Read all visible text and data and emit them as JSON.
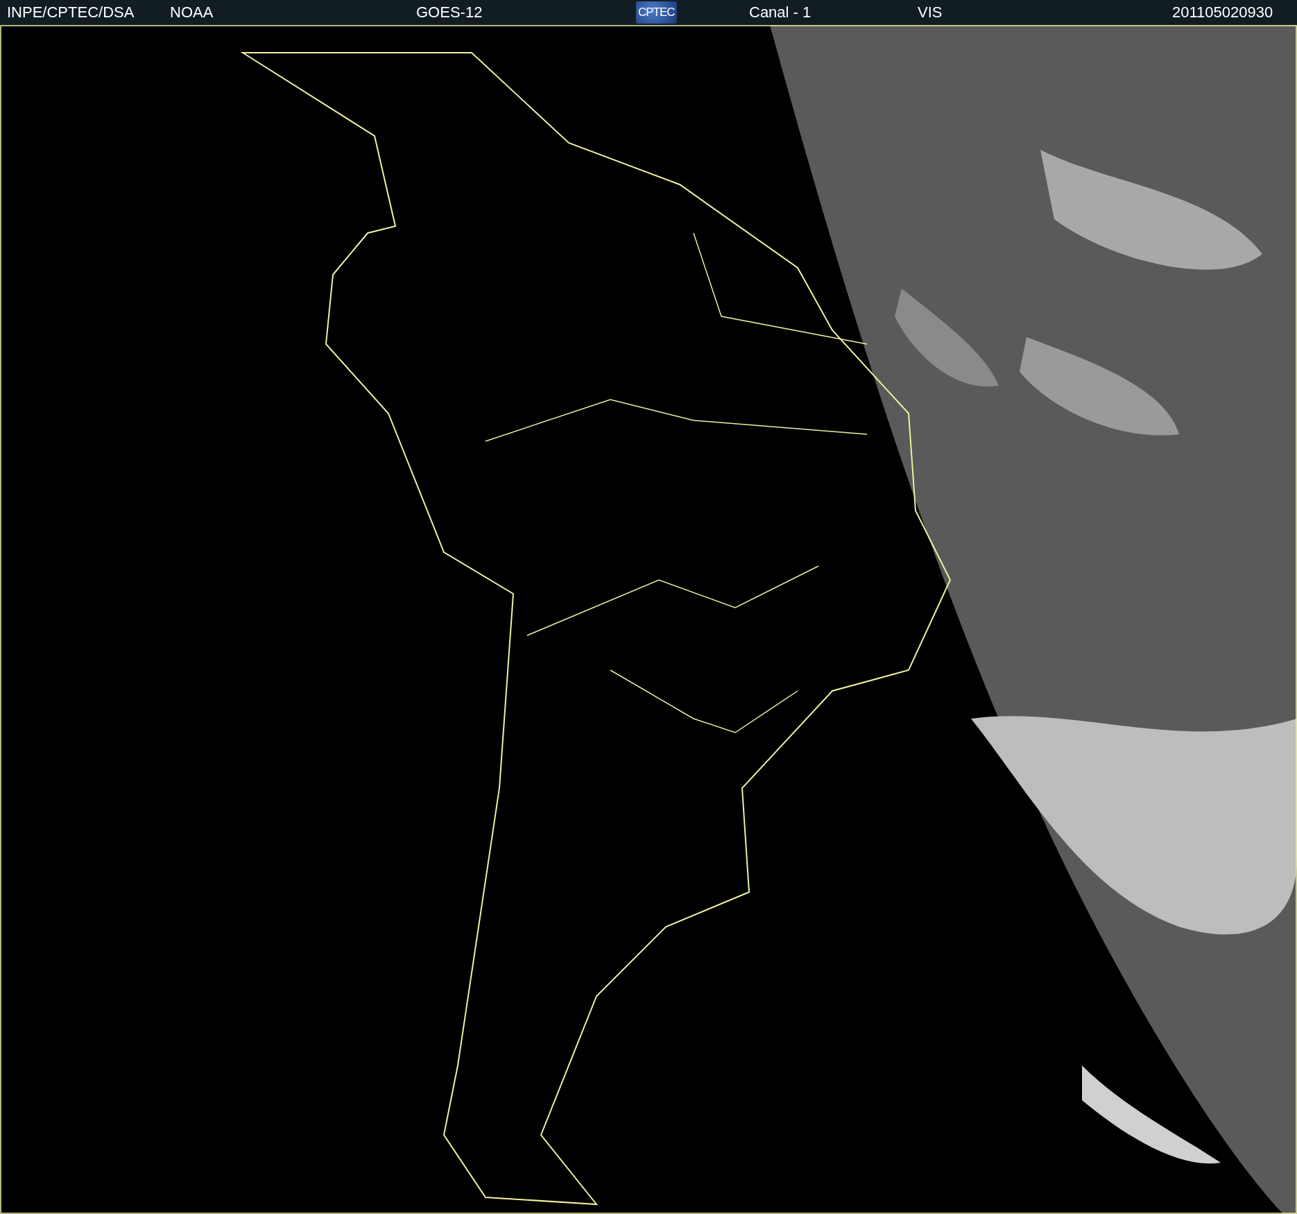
{
  "header": {
    "items": [
      {
        "kind": "text",
        "text": "INPE/CPTEC/DSA"
      },
      {
        "kind": "text",
        "text": "NOAA"
      },
      {
        "kind": "text",
        "text": "GOES-12"
      },
      {
        "kind": "logo",
        "text": "CPTEC"
      },
      {
        "kind": "text",
        "text": "Canal - 1"
      },
      {
        "kind": "text",
        "text": "VIS"
      },
      {
        "kind": "text",
        "text": "201105020930"
      }
    ]
  }
}
